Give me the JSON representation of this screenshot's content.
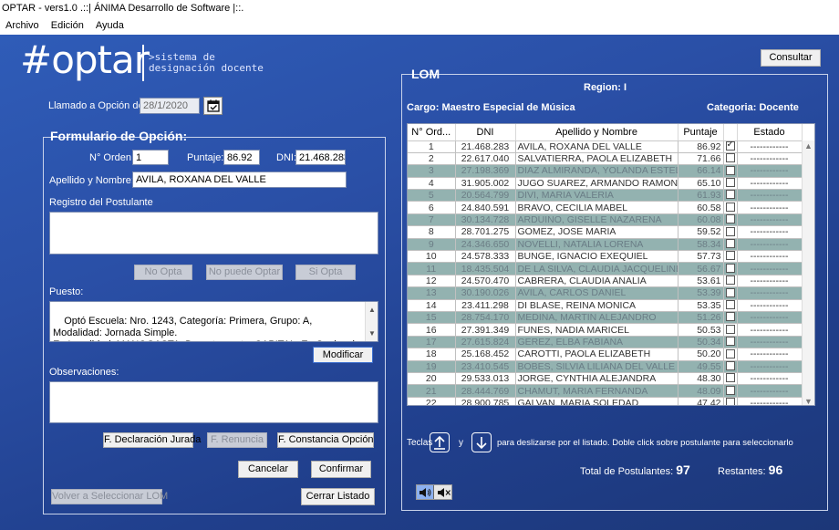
{
  "window": {
    "title": "OPTAR - vers1.0 .::| ÁNIMA Desarrollo de Software |::."
  },
  "menu": [
    "Archivo",
    "Edición",
    "Ayuda"
  ],
  "logo": {
    "text": "#optar",
    "subtitle": ">sistema de\ndesignación docente"
  },
  "top": {
    "consultar": "Consultar"
  },
  "llamado": {
    "label": "Llamado a Opción del:",
    "value": "28/1/2020"
  },
  "form": {
    "title": "Formulario de Opción:",
    "orden_label": "N° Orden:",
    "orden": "1",
    "puntaje_label": "Puntaje:",
    "puntaje": "86.92",
    "dni_label": "DNI:",
    "dni": "21.468.283",
    "apellido_label": "Apellido y Nombre:",
    "apellido": "AVILA, ROXANA DEL VALLE",
    "registro_label": "Registro del Postulante",
    "no_opta": "No Opta",
    "no_puede": "No puede Optar",
    "si_opta": "Si Opta",
    "puesto_label": "Puesto:",
    "puesto_text": "Optó Escuela: Nro. 1243, Categoría: Primera, Grupo: A, Modalidad: Jornada Simple.\nEn Localidad: MANOGASTA, Departamento: CAPITAL. En Suplencia por",
    "modificar": "Modificar",
    "obs_label": "Observaciones:",
    "f_declaracion": "F. Declaración Jurada",
    "f_renuncia": "F. Renuncia",
    "f_constancia": "F. Constancia Opción",
    "cancelar": "Cancelar",
    "confirmar": "Confirmar",
    "volver": "Volver a Seleccionar LOM",
    "cerrar": "Cerrar Listado"
  },
  "lom": {
    "title": "LOM",
    "region": "Region: I",
    "cargo": "Cargo: Maestro Especial de Música",
    "categoria": "Categoria: Docente",
    "columns": [
      "N° Ord...",
      "DNI",
      "Apellido y Nombre",
      "Puntaje",
      "",
      "Estado"
    ],
    "rows": [
      [
        "1",
        "21.468.283",
        "AVILA, ROXANA DEL VALLE",
        "86.92",
        true,
        "------------",
        false
      ],
      [
        "2",
        "22.617.040",
        "SALVATIERRA, PAOLA  ELIZABETH",
        "71.66",
        false,
        "------------",
        false
      ],
      [
        "3",
        "27.198.369",
        "DIAZ ALMIRANDA, YOLANDA ESTELA",
        "66.14",
        false,
        "------------",
        true
      ],
      [
        "4",
        "31.905.002",
        "JUGO SUAREZ, ARMANDO RAMON D...",
        "65.10",
        false,
        "------------",
        false
      ],
      [
        "5",
        "20.564.799",
        "DIVI, MARIA VALERIA",
        "61.93",
        false,
        "------------",
        true
      ],
      [
        "6",
        "24.840.591",
        "BRAVO, CECILIA MABEL",
        "60.58",
        false,
        "------------",
        false
      ],
      [
        "7",
        "30.134.728",
        "ARDUINO, GISELLE NAZARENA",
        "60.08",
        false,
        "------------",
        true
      ],
      [
        "8",
        "28.701.275",
        "GOMEZ, JOSE MARIA",
        "59.52",
        false,
        "------------",
        false
      ],
      [
        "9",
        "24.346.650",
        "NOVELLI, NATALIA LORENA",
        "58.34",
        false,
        "------------",
        true
      ],
      [
        "10",
        "24.578.333",
        "BUNGE, IGNACIO EXEQUIEL",
        "57.73",
        false,
        "------------",
        false
      ],
      [
        "11",
        "18.435.504",
        "DE LA SILVA, CLAUDIA JACQUELINE",
        "56.67",
        false,
        "------------",
        true
      ],
      [
        "12",
        "24.570.470",
        "CABRERA, CLAUDIA ANALIA",
        "53.61",
        false,
        "------------",
        false
      ],
      [
        "13",
        "30.190.026",
        "AVILA, CARLOS DANIEL",
        "53.39",
        false,
        "------------",
        true
      ],
      [
        "14",
        "23.411.298",
        "DI BLASE, REINA MONICA",
        "53.35",
        false,
        "------------",
        false
      ],
      [
        "15",
        "28.754.170",
        "MEDINA, MARTIN ALEJANDRO",
        "51.26",
        false,
        "------------",
        true
      ],
      [
        "16",
        "27.391.349",
        "FUNES, NADIA MARICEL",
        "50.53",
        false,
        "------------",
        false
      ],
      [
        "17",
        "27.615.824",
        "GEREZ, ELBA FABIANA",
        "50.34",
        false,
        "------------",
        true
      ],
      [
        "18",
        "25.168.452",
        "CAROTTI, PAOLA ELIZABETH",
        "50.20",
        false,
        "------------",
        false
      ],
      [
        "19",
        "23.410.545",
        "BOBES, SILVIA LILIANA DEL VALLE",
        "49.55",
        false,
        "------------",
        true
      ],
      [
        "20",
        "29.533.013",
        "JORGE, CYNTHIA ALEJANDRA",
        "48.30",
        false,
        "------------",
        false
      ],
      [
        "21",
        "28.444.769",
        "CHAMUT, MARIA FERNANDA",
        "48.09",
        false,
        "------------",
        true
      ],
      [
        "22",
        "28.900.785",
        "GALVAN, MARIA SOLEDAD",
        "47.42",
        false,
        "------------",
        false
      ]
    ],
    "teclas": "Teclas",
    "y": "y",
    "hint": "para deslizarse por el listado. Doble click sobre postulante para seleccionarlo",
    "total_label": "Total de Postulantes:",
    "total": "97",
    "restantes_label": "Restantes:",
    "restantes": "96"
  }
}
